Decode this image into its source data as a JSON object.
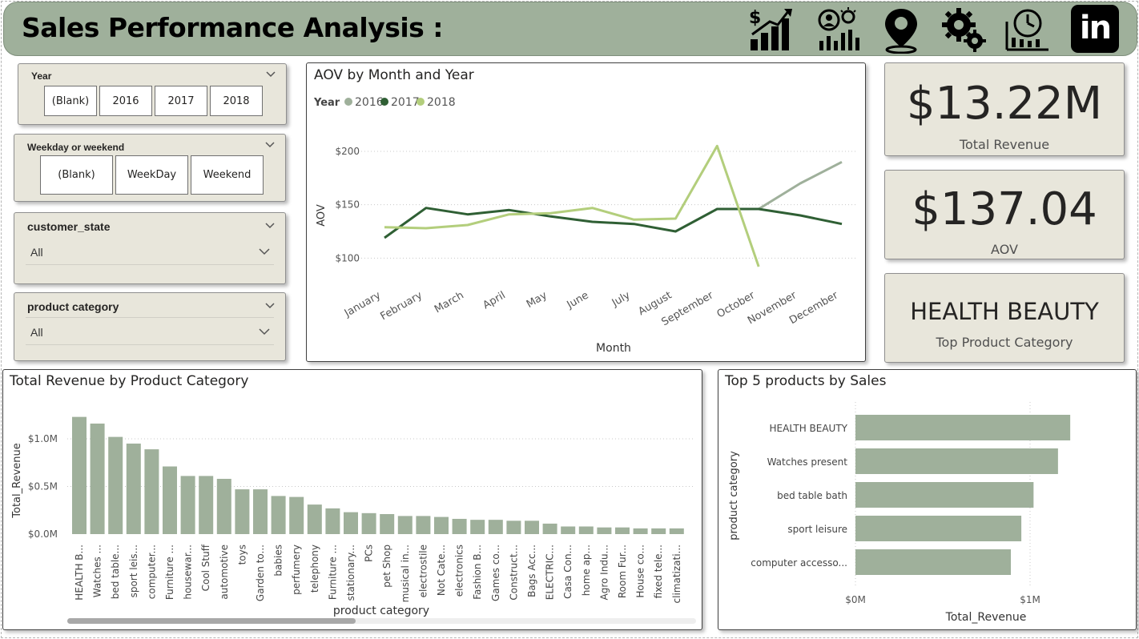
{
  "header": {
    "title": "Sales Performance Analysis :",
    "icons": [
      "sales-growth-icon",
      "analytics-people-icon",
      "location-pin-icon",
      "settings-gears-icon",
      "time-chart-icon",
      "linkedin-icon"
    ],
    "linkedin_text": "in"
  },
  "colors": {
    "header_bg": "#9fb09b",
    "card_bg": "#e8e6db",
    "series_2016": "#9fb09b",
    "series_2017": "#2f5f34",
    "series_2018": "#b3ce7c",
    "bar": "#9fb09b"
  },
  "slicers": {
    "year": {
      "title": "Year",
      "options": [
        "(Blank)",
        "2016",
        "2017",
        "2018"
      ]
    },
    "weekday": {
      "title": "Weekday or weekend",
      "options": [
        "(Blank)",
        "WeekDay",
        "Weekend"
      ]
    },
    "state": {
      "title": "customer_state",
      "value": "All"
    },
    "category": {
      "title": "product category",
      "value": "All"
    }
  },
  "kpis": {
    "revenue": {
      "value": "$13.22M",
      "label": "Total Revenue"
    },
    "aov": {
      "value": "$137.04",
      "label": "AOV"
    },
    "top_category": {
      "value": "HEALTH BEAUTY",
      "label": "Top Product Category"
    }
  },
  "charts": {
    "aov": {
      "title": "AOV by Month and Year",
      "legend_title": "Year",
      "xlabel": "Month",
      "ylabel": "AOV",
      "y_ticks": [
        "$100",
        "$150",
        "$200"
      ]
    },
    "revenue_by_category": {
      "title": "Total Revenue by Product Category",
      "xlabel": "product category",
      "ylabel": "Total_Revenue",
      "y_ticks": [
        "$0.0M",
        "$0.5M",
        "$1.0M"
      ]
    },
    "top5": {
      "title": "Top 5 products by Sales",
      "xlabel": "Total_Revenue",
      "ylabel": "product category",
      "x_ticks": [
        "$0M",
        "$1M"
      ]
    }
  },
  "chart_data": [
    {
      "type": "line",
      "title": "AOV by Month and Year",
      "xlabel": "Month",
      "ylabel": "AOV",
      "categories": [
        "January",
        "February",
        "March",
        "April",
        "May",
        "June",
        "July",
        "August",
        "September",
        "October",
        "November",
        "December"
      ],
      "ylim": [
        80,
        215
      ],
      "legend": "top-left",
      "grid": true,
      "series": [
        {
          "name": "2016",
          "values": [
            null,
            null,
            null,
            null,
            null,
            null,
            null,
            null,
            null,
            146,
            170,
            190
          ]
        },
        {
          "name": "2017",
          "values": [
            119,
            147,
            141,
            145,
            139,
            134,
            132,
            125,
            146,
            146,
            140,
            132
          ]
        },
        {
          "name": "2018",
          "values": [
            129,
            128,
            131,
            141,
            142,
            147,
            136,
            137,
            205,
            92,
            null,
            null
          ]
        }
      ]
    },
    {
      "type": "bar",
      "title": "Total Revenue by Product Category",
      "xlabel": "product category",
      "ylabel": "Total_Revenue",
      "ylim": [
        0,
        1.25
      ],
      "grid": true,
      "categories": [
        "HEALTH B...",
        "Watches ...",
        "bed table...",
        "sport leis...",
        "computer...",
        "Furniture ...",
        "housewar...",
        "Cool Stuff",
        "automotive",
        "toys",
        "Garden to...",
        "babies",
        "perfumery",
        "telephony",
        "Furniture ...",
        "stationary...",
        "PCs",
        "pet Shop",
        "musical in...",
        "electrostile",
        "Not Cate...",
        "electronics",
        "Fashion B...",
        "Games co...",
        "Construct...",
        "Bags Acc...",
        "ELECTRIC...",
        "Casa Con...",
        "home ap...",
        "Agro Indu...",
        "Room Fur...",
        "House co...",
        "fixed tele...",
        "climatizati..."
      ],
      "values": [
        1.23,
        1.16,
        1.02,
        0.95,
        0.89,
        0.71,
        0.61,
        0.61,
        0.58,
        0.47,
        0.47,
        0.4,
        0.39,
        0.31,
        0.27,
        0.23,
        0.22,
        0.21,
        0.19,
        0.19,
        0.18,
        0.16,
        0.15,
        0.15,
        0.14,
        0.14,
        0.11,
        0.08,
        0.08,
        0.07,
        0.07,
        0.06,
        0.06,
        0.06
      ]
    },
    {
      "type": "bar",
      "orientation": "horizontal",
      "title": "Top 5 products by Sales",
      "xlabel": "Total_Revenue",
      "ylabel": "product category",
      "xlim": [
        0,
        1.3
      ],
      "categories": [
        "HEALTH BEAUTY",
        "Watches present",
        "bed table bath",
        "sport leisure",
        "computer accesso..."
      ],
      "values": [
        1.23,
        1.16,
        1.02,
        0.95,
        0.89
      ]
    }
  ]
}
